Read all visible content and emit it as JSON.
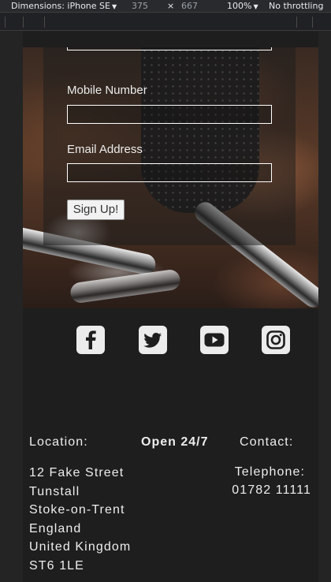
{
  "devtools": {
    "device_label": "Dimensions: iPhone SE",
    "width": "375",
    "times": "×",
    "height": "667",
    "zoom": "100%",
    "throttle": "No throttling"
  },
  "form": {
    "mobile_label": "Mobile Number",
    "mobile_value": "",
    "email_label": "Email Address",
    "email_value": "",
    "submit_label": "Sign Up!"
  },
  "social": [
    {
      "icon": "facebook-icon"
    },
    {
      "icon": "twitter-icon"
    },
    {
      "icon": "youtube-icon"
    },
    {
      "icon": "instagram-icon"
    }
  ],
  "footer": {
    "location_heading": "Location:",
    "hours": "Open 24/7",
    "contact_heading": "Contact:",
    "address": [
      "12 Fake Street",
      "Tunstall",
      "Stoke-on-Trent",
      "England",
      "United Kingdom",
      "ST6 1LE"
    ],
    "telephone_label": "Telephone:",
    "telephone_number": "01782 11111"
  }
}
